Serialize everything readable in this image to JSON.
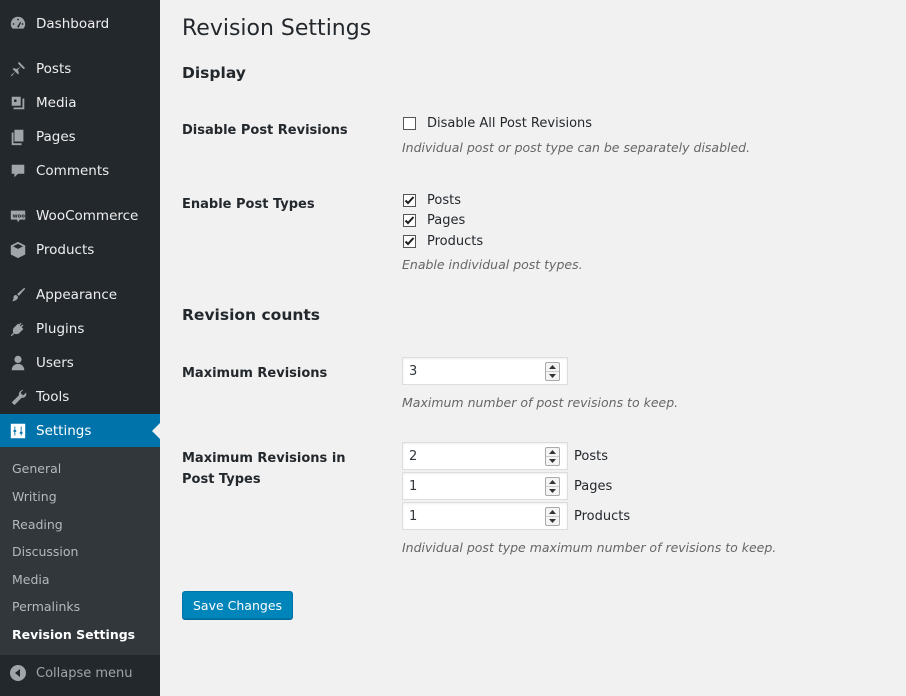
{
  "sidebar": {
    "items": [
      {
        "label": "Dashboard",
        "icon": "dashboard-icon"
      },
      {
        "label": "Posts",
        "icon": "pin-icon"
      },
      {
        "label": "Media",
        "icon": "media-icon"
      },
      {
        "label": "Pages",
        "icon": "pages-icon"
      },
      {
        "label": "Comments",
        "icon": "comment-icon"
      },
      {
        "label": "WooCommerce",
        "icon": "woocommerce-icon"
      },
      {
        "label": "Products",
        "icon": "box-icon"
      },
      {
        "label": "Appearance",
        "icon": "brush-icon"
      },
      {
        "label": "Plugins",
        "icon": "plug-icon"
      },
      {
        "label": "Users",
        "icon": "user-icon"
      },
      {
        "label": "Tools",
        "icon": "wrench-icon"
      },
      {
        "label": "Settings",
        "icon": "sliders-icon",
        "active": true
      }
    ],
    "submenu": [
      "General",
      "Writing",
      "Reading",
      "Discussion",
      "Media",
      "Permalinks",
      "Revision Settings"
    ],
    "current_submenu": "Revision Settings",
    "collapse_label": "Collapse menu",
    "colors": {
      "bg": "#23282d",
      "submenu_bg": "#32373c",
      "active": "#0073aa"
    }
  },
  "page": {
    "title": "Revision Settings",
    "display_heading": "Display",
    "disable_label": "Disable Post Revisions",
    "disable_option": "Disable All Post Revisions",
    "disable_checked": false,
    "disable_desc": "Individual post or post type can be separately disabled.",
    "enable_label": "Enable Post Types",
    "post_types": [
      {
        "label": "Posts",
        "checked": true
      },
      {
        "label": "Pages",
        "checked": true
      },
      {
        "label": "Products",
        "checked": true
      }
    ],
    "enable_desc": "Enable individual post types.",
    "counts_heading": "Revision counts",
    "max_label": "Maximum Revisions",
    "max_value": "3",
    "max_desc": "Maximum number of post revisions to keep.",
    "max_pt_label": "Maximum Revisions in Post Types",
    "max_pt": [
      {
        "value": "2",
        "label": "Posts"
      },
      {
        "value": "1",
        "label": "Pages"
      },
      {
        "value": "1",
        "label": "Products"
      }
    ],
    "max_pt_desc": "Individual post type maximum number of revisions to keep.",
    "save_label": "Save Changes",
    "accent": "#0085ba"
  }
}
